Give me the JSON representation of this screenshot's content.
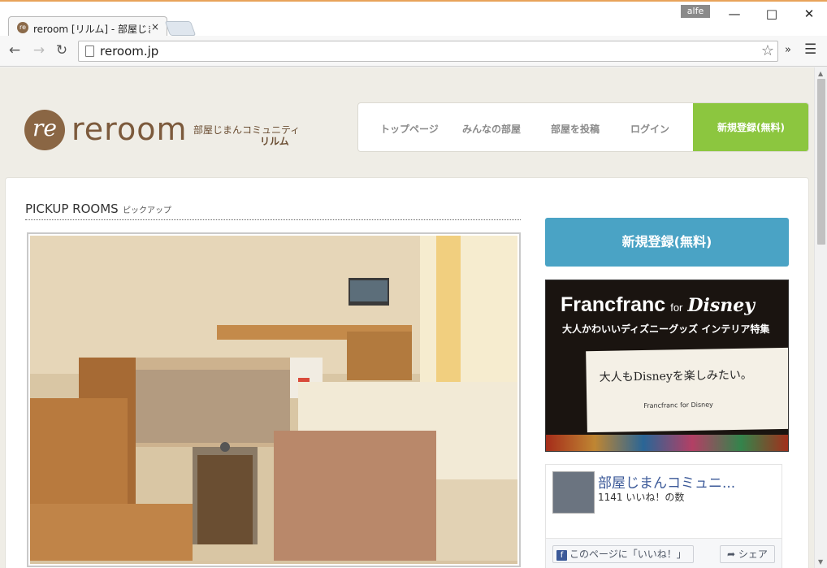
{
  "browser": {
    "tab_title": "reroom [リルム] - 部屋じまん",
    "tab_close": "×",
    "profile": "alfe",
    "url": "reroom.jp"
  },
  "site": {
    "logo_text": "reroom",
    "logo_mark_glyph": "re",
    "tagline_line1": "部屋じまんコミュニティ",
    "tagline_line2": "リルム"
  },
  "nav": {
    "items": [
      {
        "label": "トップページ"
      },
      {
        "label": "みんなの部屋"
      },
      {
        "label": "部屋を投稿"
      },
      {
        "label": "ログイン"
      }
    ],
    "signup": "新規登録(無料)",
    "signup_color": "#8cc63f"
  },
  "main": {
    "section_title": "PICKUP ROOMS",
    "section_sub": "ピックアップ"
  },
  "sidebar": {
    "signup_button": "新規登録(無料)",
    "signup_color": "#4aa3c5",
    "banner": {
      "brand": "Francfranc",
      "for": "for",
      "disney": "Disney",
      "subtitle": "大人かわいいディズニーグッズ インテリア特集",
      "box_text": "大人もDisneyを楽しみたい。",
      "box_brand": "Francfranc for Disney"
    },
    "facebook": {
      "page_name": "部屋じまんコミュニ...",
      "likes": "1141 いいね！の数",
      "like_button": "このページに「いいね！」",
      "share_button": "シェア"
    }
  }
}
